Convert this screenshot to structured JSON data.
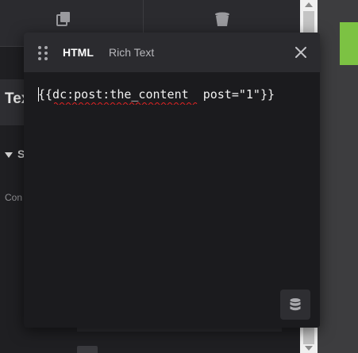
{
  "modal": {
    "tabs": [
      {
        "label": "HTML",
        "active": true
      },
      {
        "label": "Rich Text",
        "active": false
      }
    ],
    "editor": {
      "content": "{{dc:post:the_content  post=\"1\"}}"
    }
  },
  "background": {
    "tab_text": "Tex",
    "section_text": "S",
    "label_text": "Con"
  },
  "icons": {
    "drag": "drag-handle-icon",
    "close": "close-icon",
    "dynamic_data": "database-icon",
    "duplicate": "duplicate-icon",
    "trash": "trash-icon"
  },
  "colors": {
    "accent": "#7cc243",
    "modal_bg": "#1b1b1e",
    "header_bg": "#2b2b2f",
    "spellcheck": "#e02424"
  }
}
